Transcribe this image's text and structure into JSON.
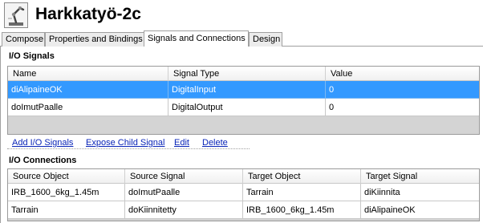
{
  "window": {
    "title": "Harkkatyö-2c",
    "icon": "robot-arm-icon"
  },
  "tabs": [
    {
      "label": "Compose",
      "active": false
    },
    {
      "label": "Properties and Bindings",
      "active": false
    },
    {
      "label": "Signals and Connections",
      "active": true
    },
    {
      "label": "Design",
      "active": false
    }
  ],
  "io_signals": {
    "title": "I/O Signals",
    "columns": [
      "Name",
      "Signal Type",
      "Value"
    ],
    "rows": [
      {
        "name": "diAlipaineOK",
        "type": "DigitalInput",
        "value": "0",
        "selected": true
      },
      {
        "name": "doImutPaalle",
        "type": "DigitalOutput",
        "value": "0",
        "selected": false
      }
    ]
  },
  "actions": {
    "add": "Add I/O Signals",
    "expose": "Expose Child Signal",
    "edit": "Edit",
    "delete": "Delete"
  },
  "io_connections": {
    "title": "I/O Connections",
    "columns": [
      "Source Object",
      "Source Signal",
      "Target Object",
      "Target Signal"
    ],
    "rows": [
      {
        "source_object": "IRB_1600_6kg_1.45m",
        "source_signal": "doImutPaalle",
        "target_object": "Tarrain",
        "target_signal": "diKiinnita"
      },
      {
        "source_object": "Tarrain",
        "source_signal": "doKiinnitetty",
        "target_object": "IRB_1600_6kg_1.45m",
        "target_signal": "diAlipaineOK"
      }
    ]
  },
  "colors": {
    "selection": "#3399ff",
    "link": "#0a25b8",
    "grid_empty": "#d4d4d4"
  }
}
